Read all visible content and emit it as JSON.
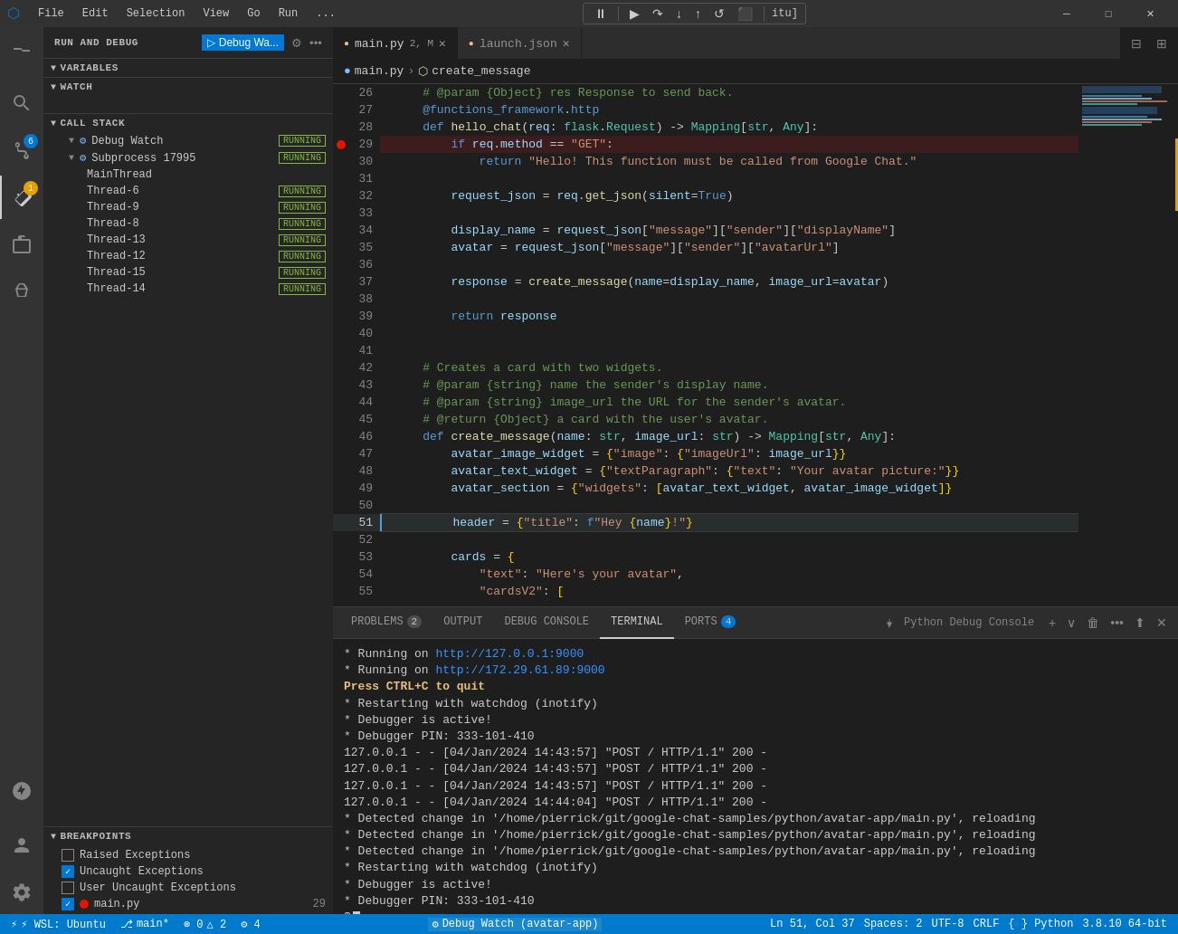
{
  "titlebar": {
    "logo": "⬡",
    "menu_items": [
      "File",
      "Edit",
      "Selection",
      "View",
      "Go",
      "Run",
      "..."
    ],
    "debug_controls": [
      "⏸",
      "↺",
      "↓",
      "↑",
      "↡",
      "↺",
      "⬛"
    ],
    "title_file": "itu]",
    "min": "─",
    "max": "□",
    "close": "✕"
  },
  "activity_bar": {
    "icons": [
      {
        "name": "explorer-icon",
        "symbol": "⎘",
        "active": true,
        "badge": null
      },
      {
        "name": "search-icon",
        "symbol": "🔍",
        "active": false,
        "badge": null
      },
      {
        "name": "source-control-icon",
        "symbol": "⑂",
        "active": false,
        "badge": "6"
      },
      {
        "name": "run-debug-icon",
        "symbol": "▷",
        "active": false,
        "badge": "1"
      },
      {
        "name": "extensions-icon",
        "symbol": "⊞",
        "active": false,
        "badge": null
      },
      {
        "name": "testing-icon",
        "symbol": "⬡",
        "active": false,
        "badge": null
      }
    ],
    "bottom_icons": [
      {
        "name": "remote-icon",
        "symbol": "⚙",
        "active": false
      },
      {
        "name": "account-icon",
        "symbol": "◯",
        "active": false
      },
      {
        "name": "settings-icon",
        "symbol": "⚙",
        "active": false
      }
    ]
  },
  "debug_panel": {
    "title": "RUN AND DEBUG",
    "config_name": "Debug Wa...",
    "sections": {
      "variables": {
        "label": "VARIABLES",
        "collapsed": false
      },
      "watch": {
        "label": "WATCH",
        "collapsed": false
      },
      "call_stack": {
        "label": "CALL STACK",
        "items": [
          {
            "indent": 1,
            "icon": "⚙",
            "name": "Debug Watch",
            "status": "RUNNING"
          },
          {
            "indent": 2,
            "icon": "⚙",
            "name": "Subprocess 17995",
            "status": "RUNNING"
          },
          {
            "indent": 3,
            "name": "MainThread",
            "status": null
          },
          {
            "indent": 3,
            "name": "Thread-6",
            "status": "RUNNING"
          },
          {
            "indent": 3,
            "name": "Thread-9",
            "status": "RUNNING"
          },
          {
            "indent": 3,
            "name": "Thread-8",
            "status": "RUNNING"
          },
          {
            "indent": 3,
            "name": "Thread-13",
            "status": "RUNNING"
          },
          {
            "indent": 3,
            "name": "Thread-12",
            "status": "RUNNING"
          },
          {
            "indent": 3,
            "name": "Thread-15",
            "status": "RUNNING"
          },
          {
            "indent": 3,
            "name": "Thread-14",
            "status": "RUNNING"
          }
        ]
      },
      "breakpoints": {
        "label": "BREAKPOINTS",
        "items": [
          {
            "checked": false,
            "text": "Raised Exceptions",
            "dot": false
          },
          {
            "checked": true,
            "text": "Uncaught Exceptions",
            "dot": false
          },
          {
            "checked": false,
            "text": "User Uncaught Exceptions",
            "dot": false
          },
          {
            "checked": true,
            "text": "main.py",
            "dot": true,
            "count": "29"
          }
        ]
      }
    }
  },
  "editor": {
    "tabs": [
      {
        "label": "main.py",
        "modified": true,
        "tag": "2, M",
        "active": true
      },
      {
        "label": "launch.json",
        "modified": false,
        "active": false
      }
    ],
    "breadcrumb": [
      "main.py",
      "create_message"
    ],
    "lines": [
      {
        "num": 26,
        "code": "    # @param {Object} res Response to send back.",
        "type": "comment"
      },
      {
        "num": 27,
        "code": "    @functions_framework.http",
        "type": "decorator"
      },
      {
        "num": 28,
        "code": "    def hello_chat(req: flask.Request) -> Mapping[str, Any]:",
        "type": "code"
      },
      {
        "num": 29,
        "code": "        if req.method == \"GET\":",
        "type": "code",
        "breakpoint": true
      },
      {
        "num": 30,
        "code": "            return \"Hello! This function must be called from Google Chat.\"",
        "type": "code"
      },
      {
        "num": 31,
        "code": "",
        "type": "empty"
      },
      {
        "num": 32,
        "code": "        request_json = req.get_json(silent=True)",
        "type": "code"
      },
      {
        "num": 33,
        "code": "",
        "type": "empty"
      },
      {
        "num": 34,
        "code": "        display_name = request_json[\"message\"][\"sender\"][\"displayName\"]",
        "type": "code"
      },
      {
        "num": 35,
        "code": "        avatar = request_json[\"message\"][\"sender\"][\"avatarUrl\"]",
        "type": "code"
      },
      {
        "num": 36,
        "code": "",
        "type": "empty"
      },
      {
        "num": 37,
        "code": "        response = create_message(name=display_name, image_url=avatar)",
        "type": "code"
      },
      {
        "num": 38,
        "code": "",
        "type": "empty"
      },
      {
        "num": 39,
        "code": "        return response",
        "type": "code"
      },
      {
        "num": 40,
        "code": "",
        "type": "empty"
      },
      {
        "num": 41,
        "code": "",
        "type": "empty"
      },
      {
        "num": 42,
        "code": "    # Creates a card with two widgets.",
        "type": "comment"
      },
      {
        "num": 43,
        "code": "    # @param {string} name the sender's display name.",
        "type": "comment"
      },
      {
        "num": 44,
        "code": "    # @param {string} image_url the URL for the sender's avatar.",
        "type": "comment"
      },
      {
        "num": 45,
        "code": "    # @return {Object} a card with the user's avatar.",
        "type": "comment"
      },
      {
        "num": 46,
        "code": "    def create_message(name: str, image_url: str) -> Mapping[str, Any]:",
        "type": "code"
      },
      {
        "num": 47,
        "code": "        avatar_image_widget = {\"image\": {\"imageUrl\": image_url}}",
        "type": "code"
      },
      {
        "num": 48,
        "code": "        avatar_text_widget = {\"textParagraph\": {\"text\": \"Your avatar picture:\"}}",
        "type": "code"
      },
      {
        "num": 49,
        "code": "        avatar_section = {\"widgets\": [avatar_text_widget, avatar_image_widget]}",
        "type": "code"
      },
      {
        "num": 50,
        "code": "",
        "type": "empty"
      },
      {
        "num": 51,
        "code": "        header = {\"title\": f\"Hey {name}!\"}",
        "type": "code",
        "current": true
      },
      {
        "num": 52,
        "code": "",
        "type": "empty"
      },
      {
        "num": 53,
        "code": "        cards = {",
        "type": "code"
      },
      {
        "num": 54,
        "code": "            \"text\": \"Here's your avatar\",",
        "type": "code"
      },
      {
        "num": 55,
        "code": "            \"cardsV2\": [",
        "type": "code"
      }
    ]
  },
  "terminal": {
    "tabs": [
      {
        "label": "PROBLEMS",
        "count": "2",
        "active": false
      },
      {
        "label": "OUTPUT",
        "count": null,
        "active": false
      },
      {
        "label": "DEBUG CONSOLE",
        "count": null,
        "active": false
      },
      {
        "label": "TERMINAL",
        "count": null,
        "active": true
      },
      {
        "label": "PORTS",
        "count": "4",
        "active": false
      }
    ],
    "python_console": "Python Debug Console",
    "lines": [
      " * Running on http://127.0.0.1:9000",
      " * Running on http://172.29.61.89:9000",
      "Press CTRL+C to quit",
      " * Restarting with watchdog (inotify)",
      " * Debugger is active!",
      " * Debugger PIN: 333-101-410",
      "127.0.0.1 - - [04/Jan/2024 14:43:57] \"POST / HTTP/1.1\" 200 -",
      "127.0.0.1 - - [04/Jan/2024 14:43:57] \"POST / HTTP/1.1\" 200 -",
      "127.0.0.1 - - [04/Jan/2024 14:43:57] \"POST / HTTP/1.1\" 200 -",
      "127.0.0.1 - - [04/Jan/2024 14:44:04] \"POST / HTTP/1.1\" 200 -",
      " * Detected change in '/home/pierrick/git/google-chat-samples/python/avatar-app/main.py', reloading",
      " * Detected change in '/home/pierrick/git/google-chat-samples/python/avatar-app/main.py', reloading",
      " * Detected change in '/home/pierrick/git/google-chat-samples/python/avatar-app/main.py', reloading",
      " * Restarting with watchdog (inotify)",
      " * Debugger is active!",
      " * Debugger PIN: 333-101-410",
      "$"
    ]
  },
  "status_bar": {
    "left": [
      {
        "text": "⚡ WSL: Ubuntu",
        "icon": "wsl-icon"
      },
      {
        "text": "⎇ main*",
        "icon": "branch-icon"
      },
      {
        "text": "⊗ 0 △ 2",
        "icon": "error-icon"
      },
      {
        "text": "⚙ 4",
        "icon": "debug-icon"
      }
    ],
    "debug": "⚙ Debug Watch (avatar-app)",
    "right": [
      {
        "text": "Ln 51, Col 37"
      },
      {
        "text": "Spaces: 2"
      },
      {
        "text": "UTF-8"
      },
      {
        "text": "CRLF"
      },
      {
        "text": "{ } Python"
      },
      {
        "text": "3.8.10 64-bit"
      }
    ]
  }
}
